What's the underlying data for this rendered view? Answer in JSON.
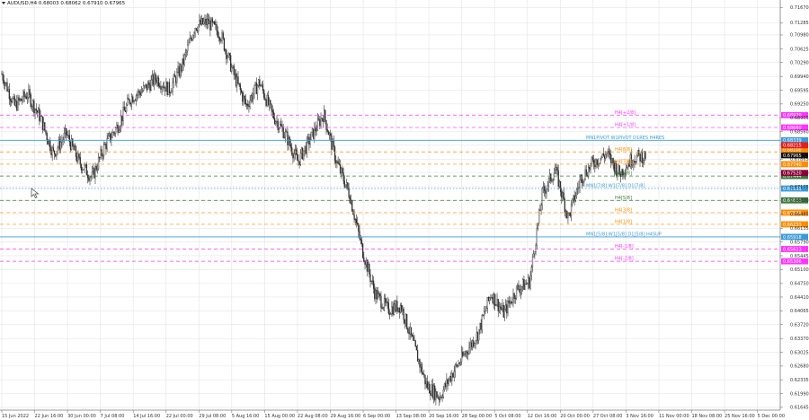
{
  "header": {
    "symbol": "AUDUSD,H4",
    "ohlc": "0.68003 0.68062 0.67910 0.67965"
  },
  "colors": {
    "grid": "#e4e4e4",
    "axis": "#7a7a7a",
    "candle": "#2a2a2a",
    "bg": "#ffffff",
    "magenta": "#ff33ff",
    "blue": "#3a9ad9",
    "orange": "#ff8c00",
    "green": "#3c7a3c",
    "grey": "#9a9a9a",
    "red": "#e41f1f",
    "darkred": "#8b0038"
  },
  "chart_data": {
    "type": "candlestick",
    "title": "",
    "ylim": [
      0.61575,
      0.71856
    ],
    "grid": true,
    "price_ticks": [
      "0.71670",
      "0.71285",
      "0.70980",
      "0.70625",
      "0.70290",
      "0.69940",
      "0.69595",
      "0.69250",
      "0.68905",
      "0.68560",
      "0.68215",
      "0.67865",
      "0.67520",
      "0.67175",
      "0.66830",
      "0.66485",
      "0.66135",
      "0.65790",
      "0.65445",
      "0.65100",
      "0.64750",
      "0.64410",
      "0.64065",
      "0.63720",
      "0.63370",
      "0.63025",
      "0.62680",
      "0.62335",
      "0.61990",
      "0.61645"
    ],
    "time_labels": [
      "15 Jun 2022",
      "22 Jun 16:00",
      "30 Jun 00:00",
      "7 Jul 08:00",
      "14 Jul 16:00",
      "22 Jul 00:00",
      "29 Jul 08:00",
      "5 Aug 16:00",
      "15 Aug 00:00",
      "22 Aug 08:00",
      "29 Aug 16:00",
      "6 Sep 00:00",
      "13 Sep 08:00",
      "20 Sep 16:00",
      "28 Sep 00:00",
      "5 Oct 08:00",
      "12 Oct 16:00",
      "20 Oct 00:00",
      "27 Oct 08:00",
      "3 Nov 16:00",
      "11 Nov 00:00",
      "18 Nov 08:00",
      "25 Nov 16:00",
      "5 Dec 00:00"
    ],
    "series": [
      {
        "x": [
          "15 Jun 2022",
          "18 Jun",
          "22 Jun 16:00",
          "26 Jun",
          "30 Jun 00:00",
          "3 Jul",
          "7 Jul 08:00",
          "11 Jul",
          "14 Jul 16:00",
          "18 Jul",
          "22 Jul 00:00",
          "26 Jul",
          "29 Jul 08:00",
          "2 Aug",
          "5 Aug 16:00",
          "11 Aug",
          "13 Aug",
          "15 Aug 00:00",
          "18 Aug",
          "22 Aug 08:00",
          "26 Aug",
          "29 Aug 16:00",
          "2 Sep",
          "6 Sep 00:00",
          "9 Sep",
          "13 Sep 08:00",
          "16 Sep",
          "20 Sep 16:00",
          "24 Sep",
          "28 Sep 00:00",
          "1 Oct",
          "5 Oct 08:00",
          "8 Oct",
          "12 Oct 16:00",
          "14 Oct",
          "16 Oct",
          "20 Oct 00:00",
          "23 Oct",
          "27 Oct 08:00",
          "30 Oct",
          "3 Nov 16:00",
          "7 Nov",
          "11 Nov 00:00",
          "14 Nov",
          "18 Nov 08:00",
          "21 Nov",
          "25 Nov 16:00",
          "28 Nov",
          "1 Dec",
          "5 Dec 00:00",
          "8 Dec"
        ],
        "y": [
          0.7,
          0.692,
          0.695,
          0.689,
          0.68,
          0.685,
          0.678,
          0.674,
          0.682,
          0.687,
          0.694,
          0.696,
          0.699,
          0.696,
          0.702,
          0.712,
          0.713,
          0.71,
          0.7,
          0.692,
          0.698,
          0.69,
          0.685,
          0.678,
          0.684,
          0.69,
          0.678,
          0.67,
          0.656,
          0.645,
          0.641,
          0.642,
          0.632,
          0.622,
          0.619,
          0.625,
          0.63,
          0.635,
          0.645,
          0.64,
          0.646,
          0.648,
          0.67,
          0.676,
          0.664,
          0.674,
          0.678,
          0.68,
          0.675,
          0.679,
          0.6795
        ]
      }
    ],
    "levels": [
      {
        "label": "H4[+2/8]",
        "price": "0.68970",
        "color": "#ff33ff",
        "style": "dashed"
      },
      {
        "label": "H4[+1/8]",
        "price": "0.68660",
        "color": "#ff33ff",
        "style": "dashed"
      },
      {
        "label": "MN1PIVOT W1PIVOT D1RES H4RES",
        "price": "0.68339",
        "color": "#3a9ad9",
        "style": "solid"
      },
      {
        "label": "H4[8/8]",
        "price": "0.68048",
        "color": "#ff8c00",
        "style": "dashed"
      },
      {
        "label": "H4[7/8]",
        "price": "0.67740",
        "color": "#ff8c00",
        "style": "dashed"
      },
      {
        "label": "H4[6/8]",
        "price": "0.67444",
        "color": "#3c7a3c",
        "style": "dashed"
      },
      {
        "label": "MN1[7/8] W1[7/8] D1[7/8]",
        "price": "0.67131",
        "color": "#3a9ad9",
        "style": "dotted"
      },
      {
        "label": "H4[5/8]",
        "price": "0.66833",
        "color": "#3c7a3c",
        "style": "dashed"
      },
      {
        "label": "H4[3/8]",
        "price": "0.66526",
        "color": "#ff8c00",
        "style": "dashed"
      },
      {
        "label": "H4[1/8]",
        "price": "0.66233",
        "color": "#ff8c00",
        "style": "dashed"
      },
      {
        "label": "MN1[5/8] W1[5/8] D1[5/8] H4SUP",
        "price": "0.65918",
        "color": "#3a9ad9",
        "style": "solid"
      },
      {
        "label": "H4[-1/8]",
        "price": "0.65613",
        "color": "#ff33ff",
        "style": "dashed"
      },
      {
        "label": "H4[-2/8]",
        "price": "0.65306",
        "color": "#ff33ff",
        "style": "dashed"
      }
    ],
    "current_price": "0.67965",
    "price_tags": [
      {
        "price": "0.67965",
        "bg": "#111111"
      },
      {
        "price": "0.68108",
        "bg": "#ff8c00"
      },
      {
        "price": "0.68215",
        "bg": "#e41f1f"
      },
      {
        "price": "0.67444",
        "bg": "#3c7a3c"
      },
      {
        "price": "0.67520",
        "bg": "#8b0038"
      }
    ]
  }
}
